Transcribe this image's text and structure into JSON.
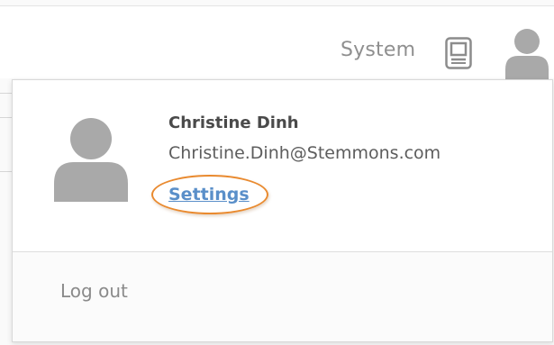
{
  "header": {
    "system_label": "System",
    "icons": [
      "device-icon",
      "user-avatar-icon"
    ]
  },
  "user_menu": {
    "name": "Christine Dinh",
    "email": "Christine.Dinh@Stemmons.com",
    "settings_label": "Settings",
    "logout_label": "Log out"
  },
  "colors": {
    "link": "#5a8fc9",
    "highlight_oval": "#e98a2f",
    "avatar_gray": "#a9a9a9"
  }
}
